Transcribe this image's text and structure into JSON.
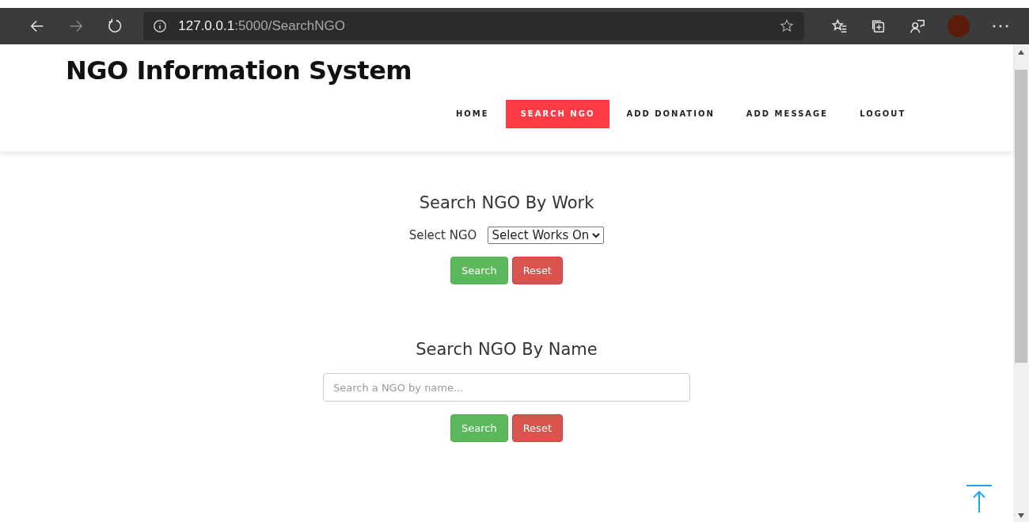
{
  "browser": {
    "url_host": "127.0.0.1",
    "url_path": ":5000/SearchNGO"
  },
  "site": {
    "title": "NGO Information System"
  },
  "nav": [
    {
      "label": "HOME",
      "selected": false
    },
    {
      "label": "SEARCH NGO",
      "selected": true
    },
    {
      "label": "ADD DONATION",
      "selected": false
    },
    {
      "label": "ADD MESSAGE",
      "selected": false
    },
    {
      "label": "LOGOUT",
      "selected": false
    }
  ],
  "sections": [
    {
      "kind": "select",
      "heading": "Search NGO By Work",
      "label": "Select NGO",
      "value": "Select Works On",
      "buttons": [
        "Search",
        "Reset"
      ]
    },
    {
      "kind": "text",
      "heading": "Search NGO By Name",
      "placeholder": "Search a NGO by name...",
      "buttons": [
        "Search",
        "Reset"
      ]
    }
  ]
}
